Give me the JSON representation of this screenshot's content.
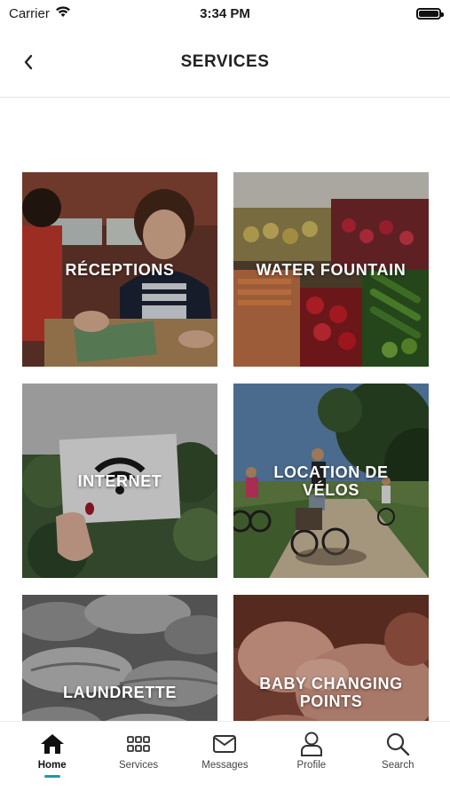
{
  "status_bar": {
    "carrier": "Carrier",
    "time": "3:34 PM"
  },
  "header": {
    "title": "SERVICES"
  },
  "services": [
    {
      "label": "RÉCEPTIONS"
    },
    {
      "label": "WATER FOUNTAIN"
    },
    {
      "label": "INTERNET"
    },
    {
      "label": "LOCATION DE VÉLOS"
    },
    {
      "label": "LAUNDRETTE"
    },
    {
      "label": "BABY CHANGING POINTS"
    }
  ],
  "tabbar": {
    "items": [
      {
        "label": "Home",
        "icon": "home-icon",
        "active": true
      },
      {
        "label": "Services",
        "icon": "grid-icon",
        "active": false
      },
      {
        "label": "Messages",
        "icon": "envelope-icon",
        "active": false
      },
      {
        "label": "Profile",
        "icon": "user-icon",
        "active": false
      },
      {
        "label": "Search",
        "icon": "search-icon",
        "active": false
      }
    ]
  },
  "colors": {
    "accent": "#1f9aa6"
  }
}
